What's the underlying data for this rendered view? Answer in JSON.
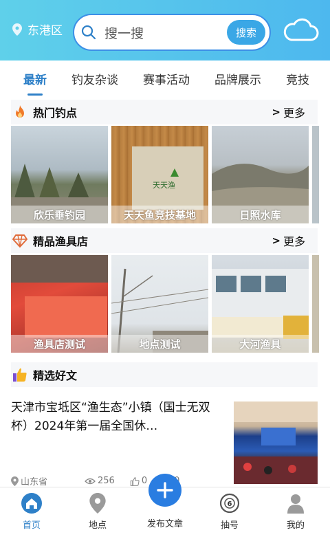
{
  "header": {
    "location": "东港区",
    "search_placeholder": "搜一搜",
    "search_button": "搜索"
  },
  "tabs": [
    {
      "label": "最新",
      "active": true
    },
    {
      "label": "钓友杂谈",
      "active": false
    },
    {
      "label": "赛事活动",
      "active": false
    },
    {
      "label": "品牌展示",
      "active": false
    },
    {
      "label": "竞技",
      "active": false
    }
  ],
  "hot_spots": {
    "title": "热门钓点",
    "more": "更多",
    "items": [
      {
        "caption": "欣乐垂钓园"
      },
      {
        "caption": "天天鱼竞技基地"
      },
      {
        "caption": "日照水库"
      }
    ]
  },
  "tackle_shops": {
    "title": "精品渔具店",
    "more": "更多",
    "items": [
      {
        "caption": "渔具店测试"
      },
      {
        "caption": "地点测试"
      },
      {
        "caption": "大河渔具"
      }
    ]
  },
  "featured": {
    "title": "精选好文",
    "article": {
      "title": "天津市宝坻区“渔生态”小镇（国士无双杯）2024年第一届全国休…",
      "location": "山东省",
      "views": "256",
      "likes": "0",
      "favorites": "0"
    }
  },
  "bottom_nav": {
    "home": "首页",
    "spots": "地点",
    "publish": "发布文章",
    "lottery": "抽号",
    "mine": "我的"
  },
  "colors": {
    "accent": "#2e80c8",
    "header_gradient_start": "#5fd0ea",
    "header_gradient_end": "#4db8ee",
    "publish_button": "#2a7de1"
  }
}
